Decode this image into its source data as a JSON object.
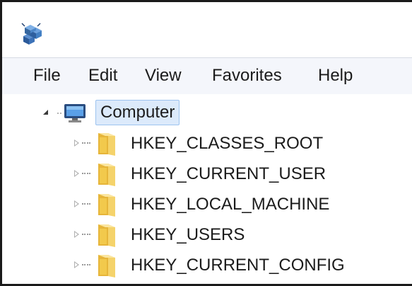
{
  "menubar": {
    "items": [
      {
        "label": "File"
      },
      {
        "label": "Edit"
      },
      {
        "label": "View"
      },
      {
        "label": "Favorites"
      },
      {
        "label": "Help"
      }
    ]
  },
  "tree": {
    "root": {
      "label": "Computer",
      "icon": "computer-icon",
      "expanded": true
    },
    "keys": [
      {
        "label": "HKEY_CLASSES_ROOT",
        "icon": "folder-icon",
        "expanded": false
      },
      {
        "label": "HKEY_CURRENT_USER",
        "icon": "folder-icon",
        "expanded": false
      },
      {
        "label": "HKEY_LOCAL_MACHINE",
        "icon": "folder-icon",
        "expanded": false
      },
      {
        "label": "HKEY_USERS",
        "icon": "folder-icon",
        "expanded": false
      },
      {
        "label": "HKEY_CURRENT_CONFIG",
        "icon": "folder-icon",
        "expanded": false
      }
    ]
  },
  "colors": {
    "selection_background": "#dceafb",
    "selection_border": "#9dc3ef",
    "menubar_background": "#f4f6fb",
    "folder_yellow": "#f2c94c"
  }
}
